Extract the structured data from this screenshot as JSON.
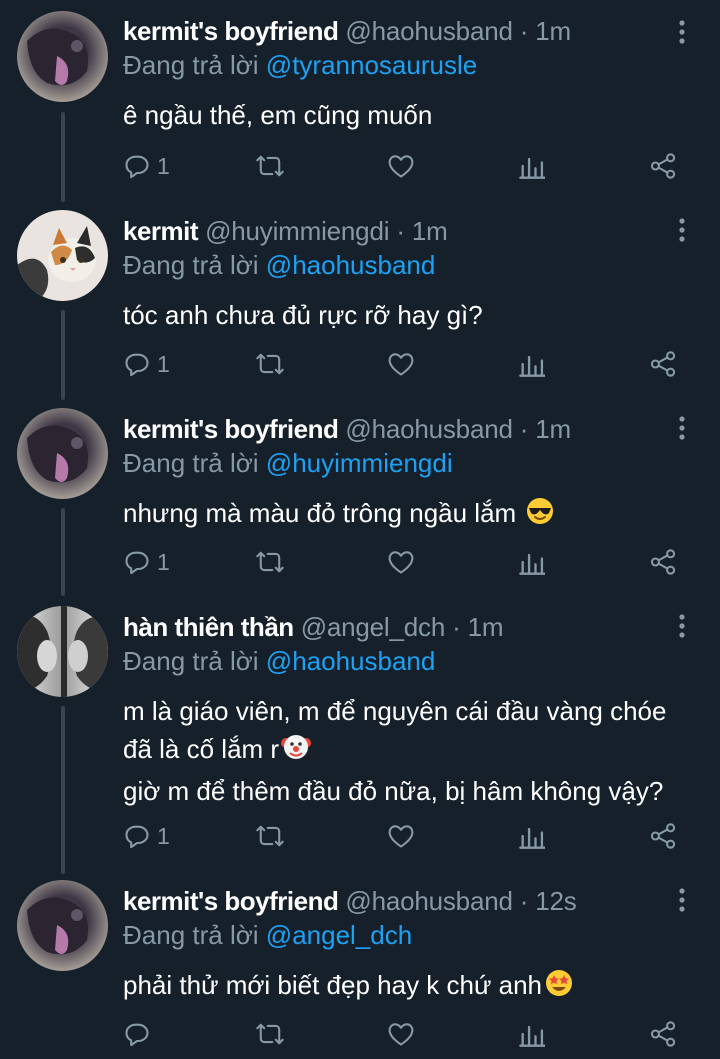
{
  "theme": {
    "background": "#15202b",
    "text": "#ffffff",
    "muted": "#8899a6",
    "accent": "#1da1f2",
    "thread_line": "#38444d"
  },
  "tweets": [
    {
      "name": "kermit's boyfriend",
      "handle": "@haohusband",
      "time": "1m",
      "reply_prefix": "Đang trả lời",
      "reply_to": "@tyrannosaurusle",
      "lines": [
        "ê ngầu thế, em cũng muốn"
      ],
      "reply_count": "1",
      "avatar": "avatar-dark-cat"
    },
    {
      "name": "kermit",
      "handle": "@huyimmiengdi",
      "time": "1m",
      "reply_prefix": "Đang trả lời",
      "reply_to": "@haohusband",
      "lines": [
        "tóc anh chưa đủ rực rỡ hay gì?"
      ],
      "reply_count": "1",
      "avatar": "avatar-calico-cat"
    },
    {
      "name": "kermit's boyfriend",
      "handle": "@haohusband",
      "time": "1m",
      "reply_prefix": "Đang trả lời",
      "reply_to": "@huyimmiengdi",
      "lines": [
        "nhưng mà màu đỏ trông ngầu lắm"
      ],
      "reply_count": "1",
      "avatar": "avatar-dark-cat",
      "emoji": "sunglasses-emoji"
    },
    {
      "name": "hàn thiên thần",
      "handle": "@angel_dch",
      "time": "1m",
      "reply_prefix": "Đang trả lời",
      "reply_to": "@haohusband",
      "lines": [
        "m là giáo viên, m để nguyên cái đầu vàng chóe",
        "đã là cố lắm r",
        "giờ m để thêm đầu đỏ nữa, bị hâm không vậy?"
      ],
      "reply_count": "1",
      "avatar": "avatar-bw-photo",
      "emoji": "clown-emoji"
    },
    {
      "name": "kermit's boyfriend",
      "handle": "@haohusband",
      "time": "12s",
      "reply_prefix": "Đang trả lời",
      "reply_to": "@angel_dch",
      "lines": [
        "phải thử mới biết đẹp hay k chứ anh"
      ],
      "reply_count": "",
      "avatar": "avatar-dark-cat",
      "emoji": "star-struck-emoji"
    }
  ],
  "separator": "·",
  "icons": {
    "reply": "reply-icon",
    "retweet": "retweet-icon",
    "like": "heart-icon",
    "analytics": "analytics-icon",
    "share": "share-icon",
    "more": "more-vertical-icon"
  }
}
